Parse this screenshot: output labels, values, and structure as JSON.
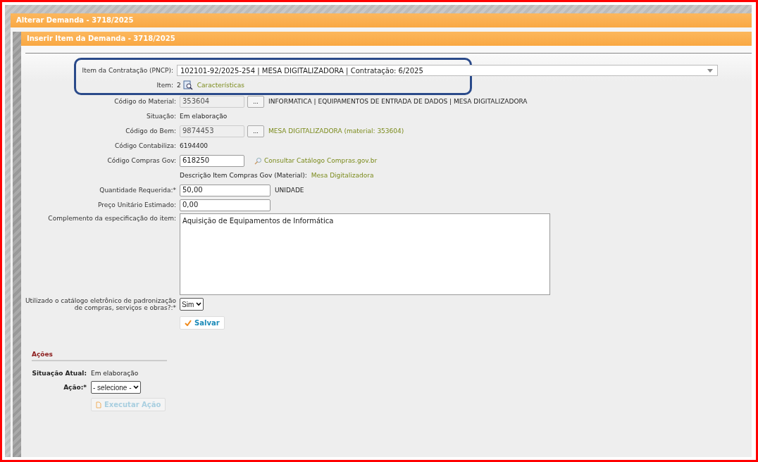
{
  "outer_dialog": {
    "title": "Alterar Demanda - 3718/2025"
  },
  "inner_dialog": {
    "title": "Inserir Item da Demanda - 3718/2025"
  },
  "fields": [
    {
      "kind": "select",
      "highlighted": true,
      "label": "Item da Contratação (PNCP):",
      "value": "102101-92/2025-254 | MESA DIGITALIZADORA | Contratação: 6/2025"
    },
    {
      "kind": "item",
      "highlighted": true,
      "label": "Item:",
      "value": "2",
      "link": "Características"
    },
    {
      "kind": "lookup",
      "label": "Código do Material:",
      "value": "353604",
      "button": "...",
      "description": "INFORMATICA | EQUIPAMENTOS DE ENTRADA DE DADOS | MESA DIGITALIZADORA",
      "description_is_link": false
    },
    {
      "kind": "text",
      "label": "Situação:",
      "value": "Em elaboração"
    },
    {
      "kind": "lookup",
      "label": "Código do Bem:",
      "value": "9874453",
      "button": "...",
      "description": "MESA DIGITALIZADORA (material: 353604)",
      "description_is_link": true
    },
    {
      "kind": "text",
      "label": "Código Contabiliza:",
      "value": "6194400"
    },
    {
      "kind": "input_link",
      "label": "Código Compras Gov:",
      "value": "618250",
      "link": "Consultar Catálogo Compras.gov.br"
    },
    {
      "kind": "note",
      "text": "Descrição Item Compras Gov (Material):",
      "link": "Mesa Digitalizadora"
    },
    {
      "kind": "input",
      "label": "Quantidade Requerida:*",
      "value": "50,00",
      "unit": "UNIDADE"
    },
    {
      "kind": "input",
      "label": "Preço Unitário Estimado:",
      "value": "0,00"
    },
    {
      "kind": "textarea",
      "label": "Complemento da especificação do item:",
      "value": "Aquisição de Equipamentos de Informática"
    },
    {
      "kind": "small_select",
      "label": "Utilizado o catálogo eletrônico de padronização de compras, serviços e obras?:*",
      "value": "Sim"
    }
  ],
  "save_button": "Salvar",
  "actions": {
    "title": "Ações",
    "status_label": "Situação Atual:",
    "status_value": "Em elaboração",
    "action_label": "Ação:*",
    "action_value": "- selecione -",
    "execute_button": {
      "label": "Executar Ação",
      "disabled": true
    }
  }
}
